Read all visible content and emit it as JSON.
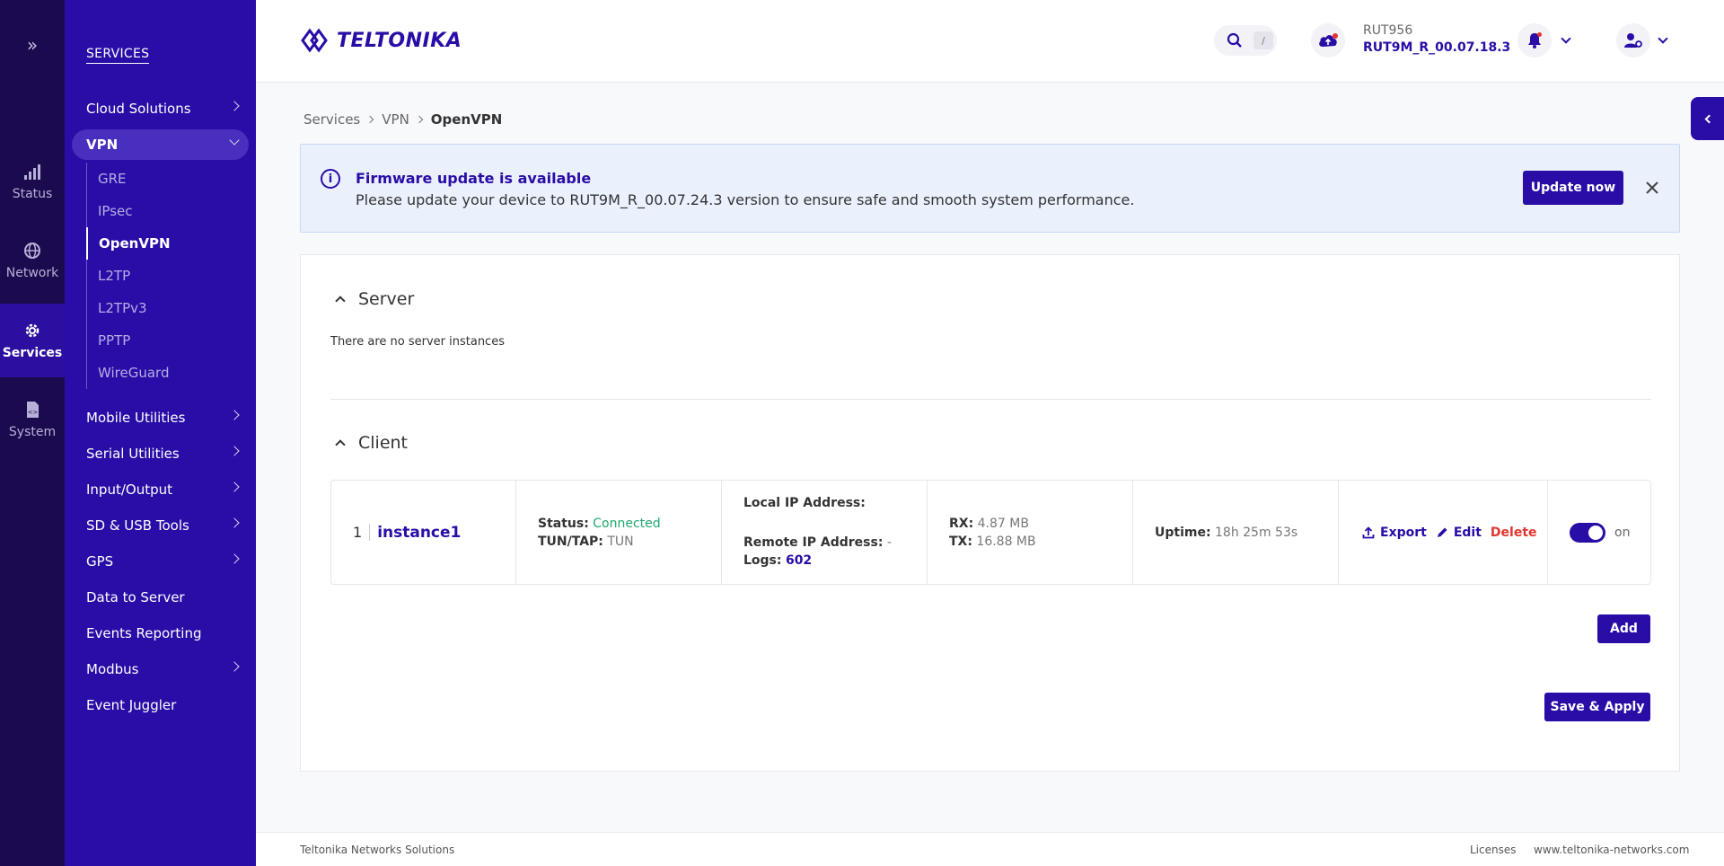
{
  "rail": {
    "items": [
      {
        "label": "Status",
        "icon": "signal-bars-icon"
      },
      {
        "label": "Network",
        "icon": "globe-icon"
      },
      {
        "label": "Services",
        "icon": "gear-icon"
      },
      {
        "label": "System",
        "icon": "document-code-icon"
      }
    ]
  },
  "sidenav": {
    "title": "SERVICES",
    "items": [
      {
        "label": "Cloud Solutions"
      },
      {
        "label": "VPN"
      },
      {
        "label": "Mobile Utilities"
      },
      {
        "label": "Serial Utilities"
      },
      {
        "label": "Input/Output"
      },
      {
        "label": "SD & USB Tools"
      },
      {
        "label": "GPS"
      },
      {
        "label": "Data to Server"
      },
      {
        "label": "Events Reporting"
      },
      {
        "label": "Modbus"
      },
      {
        "label": "Event Juggler"
      }
    ],
    "vpn_sub": [
      "GRE",
      "IPsec",
      "OpenVPN",
      "L2TP",
      "L2TPv3",
      "PPTP",
      "WireGuard"
    ]
  },
  "header": {
    "brand": "TELTONIKA",
    "search_key": "/",
    "device_name": "RUT956",
    "device_fw": "RUT9M_R_00.07.18.3"
  },
  "breadcrumb": {
    "items": [
      "Services",
      "VPN",
      "OpenVPN"
    ]
  },
  "alert": {
    "title": "Firmware update is available",
    "text": "Please update your device to RUT9M_R_00.07.24.3 version to ensure safe and smooth system performance.",
    "button": "Update now"
  },
  "server": {
    "title": "Server",
    "empty": "There are no server instances"
  },
  "client": {
    "title": "Client",
    "instance": {
      "index": "1",
      "name": "instance1",
      "status_key": "Status:",
      "status_val": "Connected",
      "tun_key": "TUN/TAP:",
      "tun_val": "TUN",
      "local_ip_key": "Local IP Address:",
      "remote_ip_key": "Remote IP Address:",
      "remote_ip_val": "-",
      "logs_key": "Logs:",
      "logs_val": "602",
      "rx_key": "RX:",
      "rx_val": "4.87 MB",
      "tx_key": "TX:",
      "tx_val": "16.88 MB",
      "uptime_key": "Uptime:",
      "uptime_val": "18h 25m 53s",
      "export": "Export",
      "edit": "Edit",
      "delete": "Delete",
      "toggle": "on"
    },
    "add": "Add",
    "save": "Save & Apply"
  },
  "footer": {
    "left": "Teltonika Networks Solutions",
    "licenses": "Licenses",
    "website": "www.teltonika-networks.com"
  },
  "colors": {
    "brand": "#2a0ca6",
    "rail": "#1c0a4e",
    "connected": "#1fa86b",
    "danger": "#e3342f"
  }
}
